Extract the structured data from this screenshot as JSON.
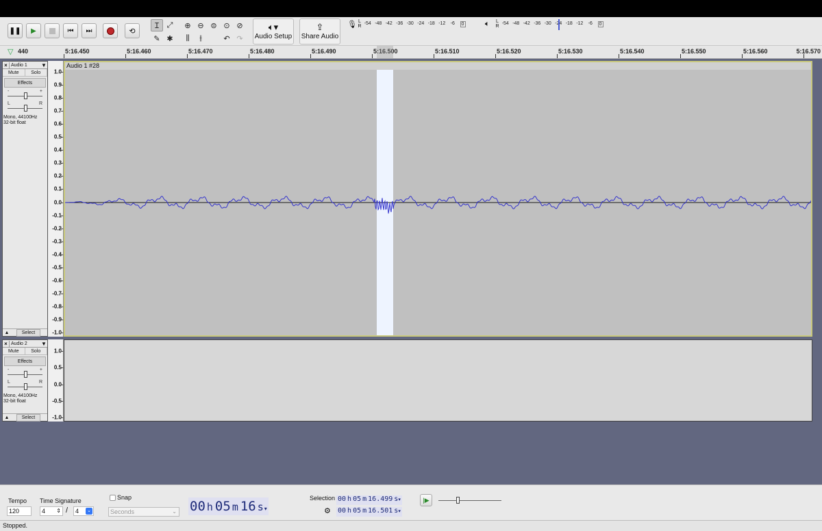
{
  "toolbar": {
    "audio_setup_label": "Audio Setup",
    "share_audio_label": "Share Audio",
    "rec_meter": {
      "l": "L",
      "r": "R",
      "scale": [
        "-54",
        "-48",
        "-42",
        "-36",
        "-30",
        "-24",
        "-18",
        "-12",
        "-6",
        "0"
      ]
    },
    "play_meter": {
      "l": "L",
      "r": "R",
      "scale": [
        "-54",
        "-48",
        "-42",
        "-36",
        "-30",
        "-24",
        "-18",
        "-12",
        "-6",
        "0"
      ]
    },
    "play_meter_level_db": -24
  },
  "ruler": {
    "labels": [
      "440",
      "5:16.450",
      "5:16.460",
      "5:16.470",
      "5:16.480",
      "5:16.490",
      "5:16.500",
      "5:16.510",
      "5:16.520",
      "5:16.530",
      "5:16.540",
      "5:16.550",
      "5:16.560",
      "5:16.570"
    ]
  },
  "tracks": [
    {
      "name": "Audio 1",
      "close": "×",
      "menu": "▼",
      "mute": "Mute",
      "solo": "Solo",
      "effects": "Effects",
      "gain_minus": "-",
      "gain_plus": "+",
      "pan_l": "L",
      "pan_r": "R",
      "info_line1": "Mono, 44100Hz",
      "info_line2": "32-bit float",
      "select": "Select",
      "clip_title": "Audio 1 #28",
      "vscale": [
        "1.0",
        "0.9",
        "0.8",
        "0.7",
        "0.6",
        "0.5",
        "0.4",
        "0.3",
        "0.2",
        "0.1",
        "0.0",
        "-0.1",
        "-0.2",
        "-0.3",
        "-0.4",
        "-0.5",
        "-0.6",
        "-0.7",
        "-0.8",
        "-0.9",
        "-1.0"
      ]
    },
    {
      "name": "Audio 2",
      "close": "×",
      "menu": "▼",
      "mute": "Mute",
      "solo": "Solo",
      "effects": "Effects",
      "gain_minus": "-",
      "gain_plus": "+",
      "pan_l": "L",
      "pan_r": "R",
      "info_line1": "Mono, 44100Hz",
      "info_line2": "32-bit float",
      "select": "Select",
      "vscale": [
        "1.0",
        "0.5",
        "0.0",
        "-0.5",
        "-1.0"
      ]
    }
  ],
  "bottom": {
    "tempo_label": "Tempo",
    "tempo_value": "120",
    "time_sig_label": "Time Signature",
    "time_sig_num": "4",
    "time_sig_slash": "/",
    "time_sig_den": "4",
    "snap_label": "Snap",
    "snap_unit": "Seconds",
    "time": {
      "h": "00",
      "h_unit": "h",
      "m": "05",
      "m_unit": "m",
      "s": "16",
      "s_unit": "s"
    },
    "selection_label": "Selection",
    "sel_start": {
      "h": "00",
      "h_unit": "h",
      "m": "05",
      "m_unit": "m",
      "s": "16.499",
      "s_unit": "s"
    },
    "sel_end": {
      "h": "00",
      "h_unit": "h",
      "m": "05",
      "m_unit": "m",
      "s": "16.501",
      "s_unit": "s"
    }
  },
  "status": "Stopped.",
  "colors": {
    "waveform": "#3333cc",
    "selection": "#eef4ff",
    "timecode_text": "#1d2a78"
  }
}
